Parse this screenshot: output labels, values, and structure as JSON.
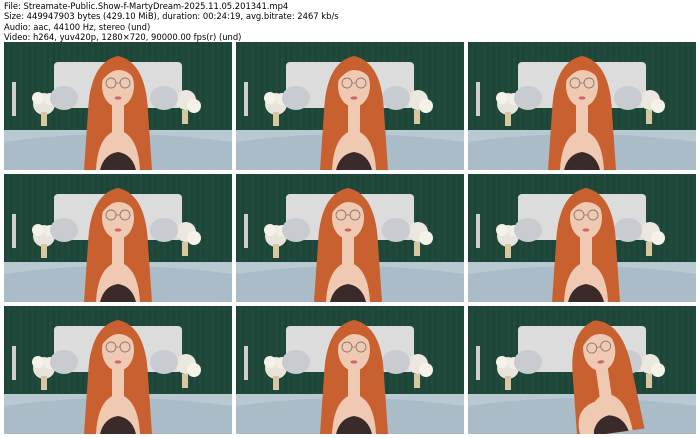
{
  "header": {
    "file_line": "File: Streamate-Public.Show-f-MartyDream-2025.11.05.201341.mp4",
    "size_line": "Size: 449947903 bytes (429.10 MiB), duration: 00:24:19, avg.bitrate: 2467 kb/s",
    "audio_line": "Audio: aac, 44100 Hz, stereo (und)",
    "video_line": "Video: h264, yuv420p, 1280×720, 90000.00 fps(r) (und)"
  },
  "thumbnails": [
    {
      "row": 0,
      "col": 0,
      "variant": "a"
    },
    {
      "row": 0,
      "col": 1,
      "variant": "b"
    },
    {
      "row": 0,
      "col": 2,
      "variant": "a"
    },
    {
      "row": 1,
      "col": 0,
      "variant": "a"
    },
    {
      "row": 1,
      "col": 1,
      "variant": "c"
    },
    {
      "row": 1,
      "col": 2,
      "variant": "b"
    },
    {
      "row": 2,
      "col": 0,
      "variant": "a"
    },
    {
      "row": 2,
      "col": 1,
      "variant": "b"
    },
    {
      "row": 2,
      "col": 2,
      "variant": "d"
    }
  ],
  "colors": {
    "wall": "#1f4a3c",
    "headboard": "#dcdcdc",
    "bed": "#b9c9d2",
    "hair": "#c8612f",
    "skin": "#f0c9b2",
    "top": "#3a2a2a"
  }
}
